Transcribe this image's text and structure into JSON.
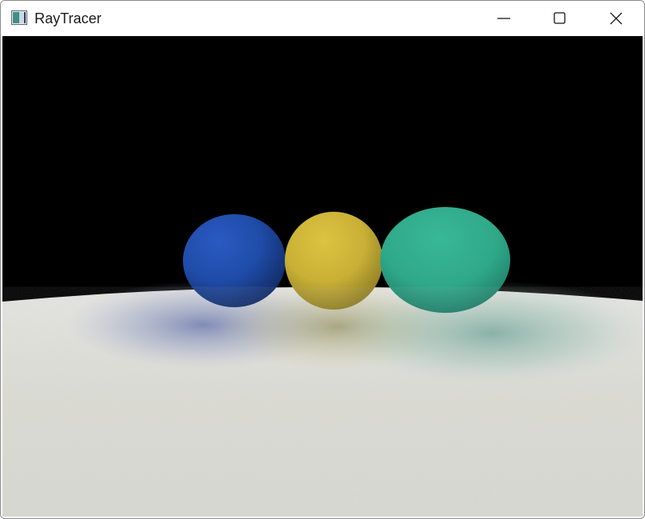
{
  "window": {
    "title": "RayTracer",
    "icons": {
      "app": "app-window-icon",
      "minimize": "minimize-icon",
      "maximize": "maximize-icon",
      "close": "close-icon"
    }
  },
  "scene": {
    "background_color": "#000000",
    "floor_color": "#dcdcd6",
    "spheres": [
      {
        "name": "blue-sphere",
        "color": "#2352b0"
      },
      {
        "name": "yellow-sphere",
        "color": "#cfb83c"
      },
      {
        "name": "teal-sphere",
        "color": "#34b092"
      }
    ]
  }
}
